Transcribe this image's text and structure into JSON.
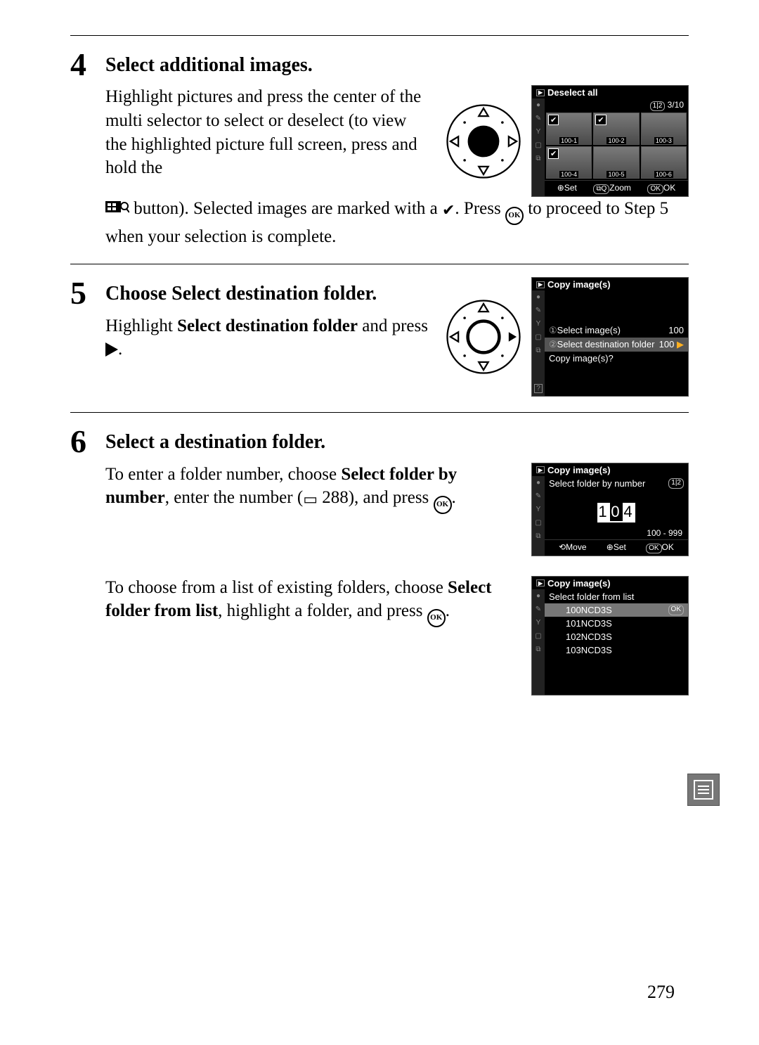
{
  "page_number": "279",
  "steps": {
    "s4": {
      "num": "4",
      "title": "Select additional images.",
      "p1a": "Highlight pictures and press the center of the multi selector to select or deselect (to view the highlighted picture full screen, press and hold the ",
      "p1b": "button).  Selected images are marked with a ",
      "p1c": ".  Press ",
      "p1d": " to proceed to Step 5 when your selection is complete."
    },
    "s5": {
      "num": "5",
      "title_a": "Choose ",
      "title_b": "Select destination folder",
      "title_c": ".",
      "p1a": "Highlight ",
      "p1b": "Select destination folder",
      "p1c": " and press "
    },
    "s6": {
      "num": "6",
      "title": "Select a destination folder.",
      "p1a": "To enter a folder number, choose ",
      "p1b": "Select folder by number",
      "p1c": ", enter the number (",
      "p1d": " 288), and press ",
      "p1e": ".",
      "p2a": "To choose from a list of existing folders, choose ",
      "p2b": "Select folder from list",
      "p2c": ", highlight a folder, and press ",
      "p2d": "."
    }
  },
  "lcd1": {
    "header": "Deselect all",
    "counter": "3/10",
    "thumbs": [
      "100-1",
      "100-2",
      "100-3",
      "100-4",
      "100-5",
      "100-6"
    ],
    "selected_flags": [
      true,
      true,
      false,
      true,
      false,
      false
    ],
    "footer": {
      "set": "Set",
      "zoom": "Zoom",
      "ok": "OK"
    }
  },
  "lcd2": {
    "header": "Copy image(s)",
    "rows": [
      {
        "label": "Select image(s)",
        "val": "100"
      },
      {
        "label": "Select destination folder",
        "val": "100"
      },
      {
        "label": "Copy image(s)?",
        "val": ""
      }
    ]
  },
  "lcd3": {
    "header": "Copy image(s)",
    "sub": "Select folder by number",
    "digits": [
      "1",
      "0",
      "4"
    ],
    "range": "100 - 999",
    "footer": {
      "move": "Move",
      "set": "Set",
      "ok": "OK"
    }
  },
  "lcd4": {
    "header": "Copy image(s)",
    "sub": "Select folder from list",
    "folders": [
      "100NCD3S",
      "101NCD3S",
      "102NCD3S",
      "103NCD3S"
    ],
    "ok": "OK"
  }
}
